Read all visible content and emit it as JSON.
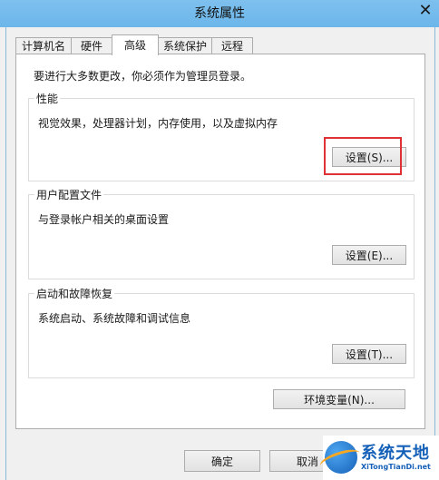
{
  "window": {
    "title": "系统属性",
    "close_glyph": "✕"
  },
  "tabs": [
    {
      "label": "计算机名",
      "active": false
    },
    {
      "label": "硬件",
      "active": false
    },
    {
      "label": "高级",
      "active": true
    },
    {
      "label": "系统保护",
      "active": false
    },
    {
      "label": "远程",
      "active": false
    }
  ],
  "notice": "要进行大多数更改，你必须作为管理员登录。",
  "performance": {
    "label": "性能",
    "description": "视觉效果，处理器计划，内存使用，以及虚拟内存",
    "button": "设置(S)..."
  },
  "user_profiles": {
    "label": "用户配置文件",
    "description": "与登录帐户相关的桌面设置",
    "button": "设置(E)..."
  },
  "startup_recovery": {
    "label": "启动和故障恢复",
    "description": "系统启动、系统故障和调试信息",
    "button": "设置(T)..."
  },
  "env_button": "环境变量(N)...",
  "footer": {
    "ok": "确定",
    "cancel": "取消"
  },
  "watermark": {
    "text": "系统天地",
    "url": "XiTongTianDi.net"
  },
  "colors": {
    "highlight": "#e03232",
    "titlebar": "#7ec0ee",
    "brand": "#1560b8"
  }
}
